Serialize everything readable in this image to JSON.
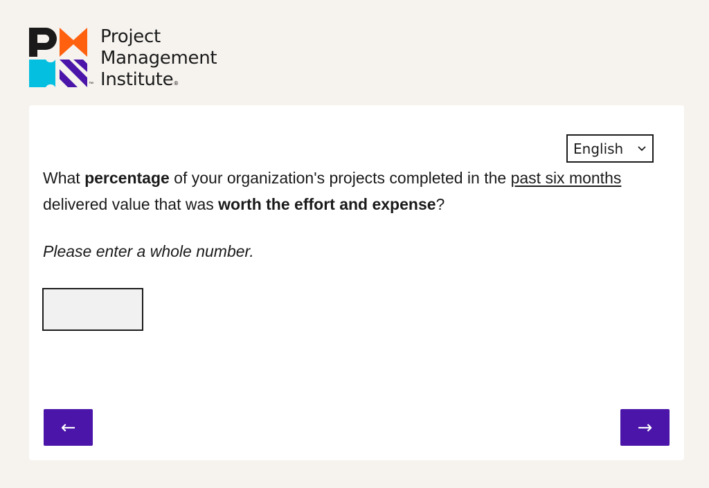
{
  "brand": {
    "line1": "Project",
    "line2": "Management",
    "line3": "Institute",
    "trademark": "™",
    "colors": {
      "black": "#1a1a1a",
      "orange": "#ff610f",
      "cyan": "#05bfe0",
      "purple": "#4a15a8"
    }
  },
  "language": {
    "selected": "English",
    "icon": "chevron-down-icon"
  },
  "question": {
    "part1": "What ",
    "bold1": "percentage",
    "part2": " of your organization's projects completed in the ",
    "underline1": "past six months",
    "part3": " delivered value that was ",
    "bold2": "worth the effort and expense",
    "part4": "?"
  },
  "hint": "Please enter a whole number.",
  "answer": {
    "value": "",
    "placeholder": ""
  },
  "nav": {
    "prev_label": "←",
    "next_label": "→",
    "button_color": "#4a15a8"
  }
}
